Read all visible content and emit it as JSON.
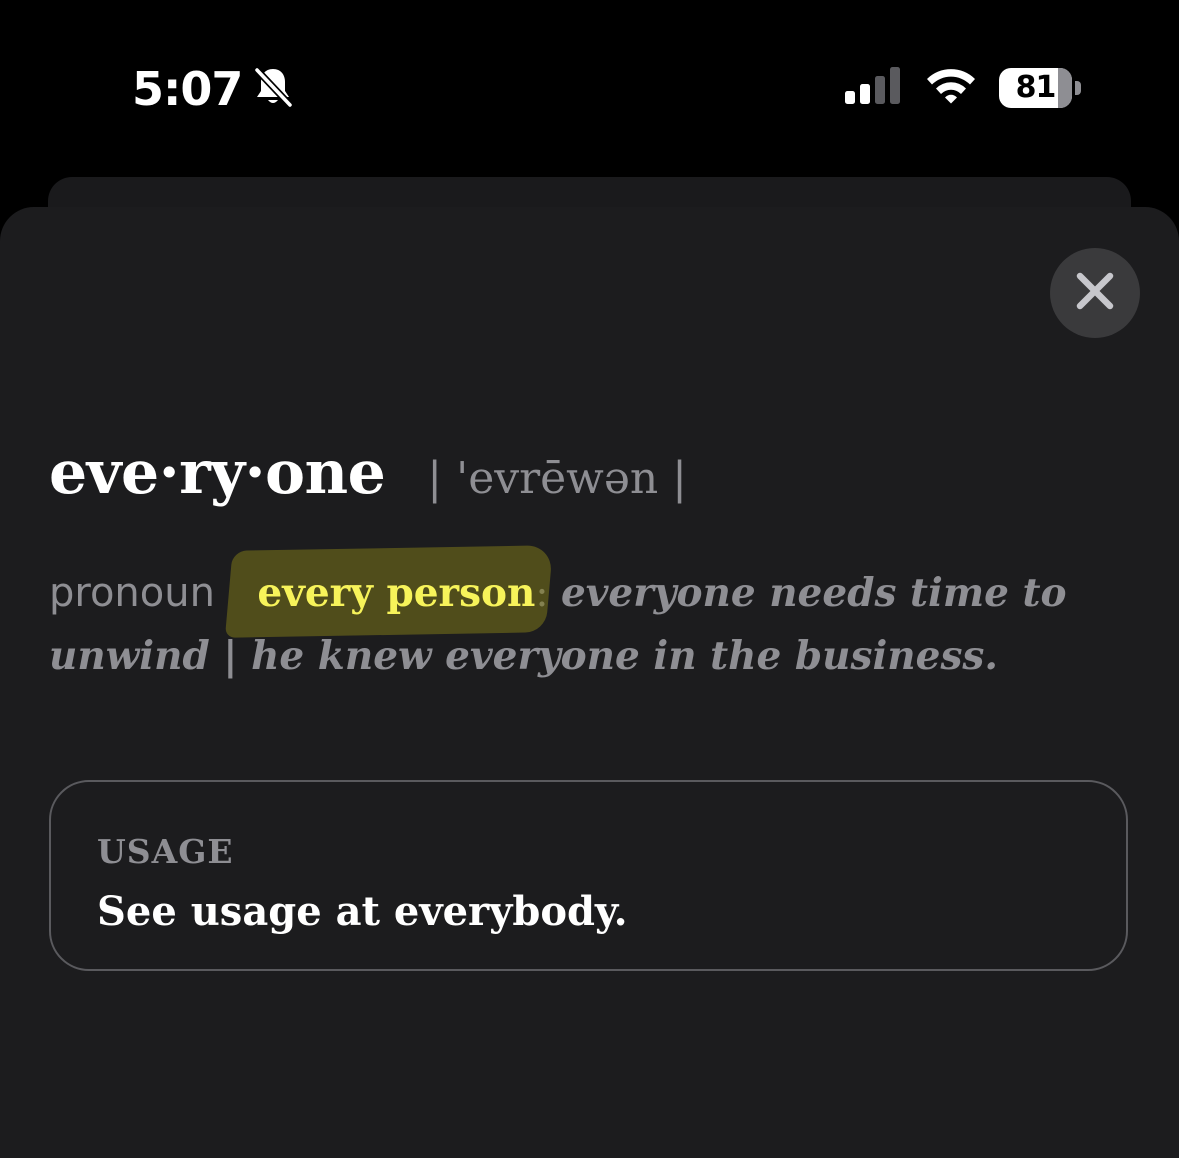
{
  "status_bar": {
    "time": "5:07",
    "battery": "81",
    "icons": [
      "bell-slash-icon",
      "cellular-signal-icon",
      "wifi-icon",
      "battery-icon"
    ]
  },
  "entry": {
    "headword": "eve·ry·one",
    "pronunciation": "| 'evrēwən |",
    "part_of_speech": "pronoun",
    "sense": "every person",
    "colon": ":",
    "example": "everyone needs time to unwind | he knew everyone in the business."
  },
  "usage": {
    "heading": "USAGE",
    "text": "See usage at everybody."
  },
  "colors": {
    "background": "#1c1c1e",
    "highlight_text": "#f7f35a",
    "secondary_text": "#8e8e93"
  }
}
